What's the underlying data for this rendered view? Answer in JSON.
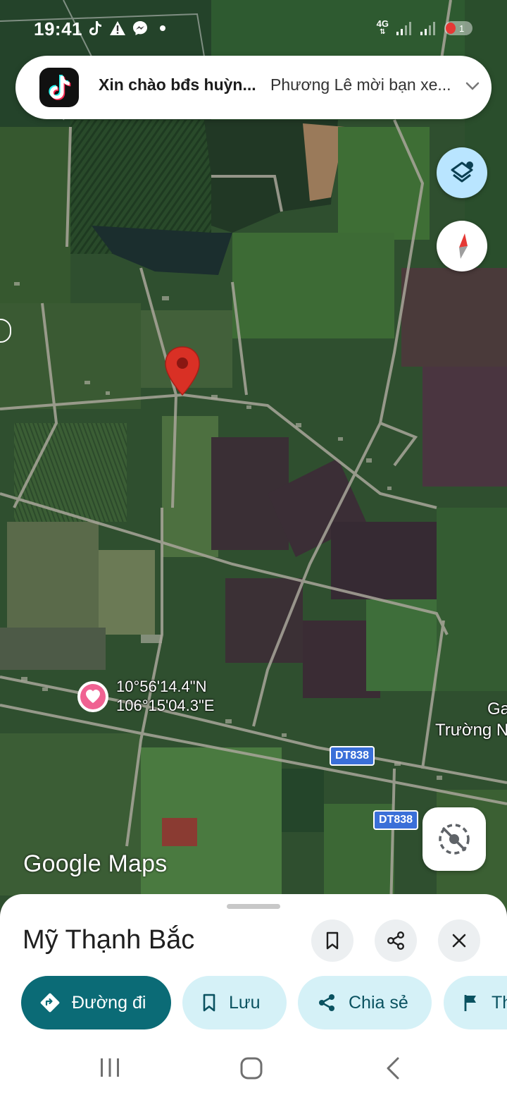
{
  "status_bar": {
    "time": "19:41",
    "network": "4G"
  },
  "notification": {
    "app_icon": "tiktok-icon",
    "title": "Xin chào bđs huỳn...",
    "body": "Phương Lê mời bạn xe..."
  },
  "map": {
    "coordinates": {
      "lat": "10°56'14.4\"N",
      "lng": "106°15'04.3\"E"
    },
    "poi_label_line1": "Ga",
    "poi_label_line2": "Trường N",
    "road_badges": [
      "DT838",
      "DT838"
    ],
    "logo": "Google Maps"
  },
  "place": {
    "title": "Mỹ Thạnh Bắc"
  },
  "actions": [
    {
      "label": "Đường đi",
      "icon": "directions-icon"
    },
    {
      "label": "Lưu",
      "icon": "bookmark-icon"
    },
    {
      "label": "Chia sẻ",
      "icon": "share-icon"
    },
    {
      "label": "Th",
      "icon": "flag-icon"
    }
  ],
  "colors": {
    "primary": "#0b6b76",
    "chip_bg": "#d5f1f7",
    "pin": "#d93025",
    "saved_pin": "#f06292"
  }
}
